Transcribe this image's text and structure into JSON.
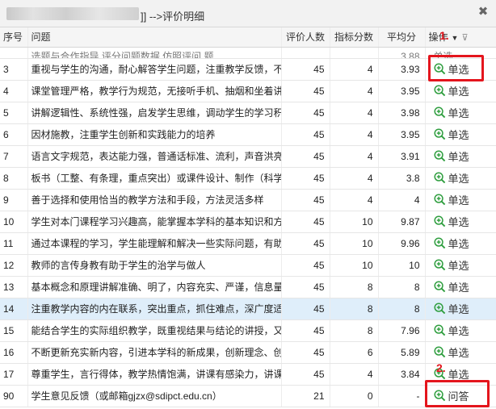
{
  "window": {
    "title": "]] -->评价明细",
    "close_icon": "close-icon"
  },
  "columns": {
    "seq": "序号",
    "question": "问题",
    "raters": "评价人数",
    "score": "指标分数",
    "avg": "平均分",
    "op": "操作"
  },
  "first_row_partial": {
    "seq": "",
    "question": "选题与合作指导 评分问题数据 仿照评问 题",
    "raters": "",
    "score": "",
    "avg": "3.88",
    "op": "单选"
  },
  "rows": [
    {
      "seq": "3",
      "question": "重视与学生的沟通，耐心解答学生问题，注重教学反馈，不断",
      "raters": "45",
      "score": "4",
      "avg": "3.93",
      "op": "单选"
    },
    {
      "seq": "4",
      "question": "课堂管理严格，教学行为规范，无接听手机、抽烟和坐着讲课",
      "raters": "45",
      "score": "4",
      "avg": "3.95",
      "op": "单选"
    },
    {
      "seq": "5",
      "question": "讲解逻辑性、系统性强，启发学生思维，调动学生的学习积极",
      "raters": "45",
      "score": "4",
      "avg": "3.98",
      "op": "单选"
    },
    {
      "seq": "6",
      "question": "因材施教，注重学生创新和实践能力的培养",
      "raters": "45",
      "score": "4",
      "avg": "3.95",
      "op": "单选"
    },
    {
      "seq": "7",
      "question": "语言文字规范，表达能力强，普通话标准、流利，声音洪亮",
      "raters": "45",
      "score": "4",
      "avg": "3.91",
      "op": "单选"
    },
    {
      "seq": "8",
      "question": "板书（工整、有条理，重点突出）或课件设计、制作（科学",
      "raters": "45",
      "score": "4",
      "avg": "3.8",
      "op": "单选"
    },
    {
      "seq": "9",
      "question": "善于选择和使用恰当的教学方法和手段，方法灵活多样",
      "raters": "45",
      "score": "4",
      "avg": "4",
      "op": "单选"
    },
    {
      "seq": "10",
      "question": "学生对本门课程学习兴趣高，能掌握本学科的基本知识和方法",
      "raters": "45",
      "score": "10",
      "avg": "9.87",
      "op": "单选"
    },
    {
      "seq": "11",
      "question": "通过本课程的学习，学生能理解和解决一些实际问题，有助于",
      "raters": "45",
      "score": "10",
      "avg": "9.96",
      "op": "单选"
    },
    {
      "seq": "12",
      "question": "教师的言传身教有助于学生的治学与做人",
      "raters": "45",
      "score": "10",
      "avg": "10",
      "op": "单选"
    },
    {
      "seq": "13",
      "question": "基本概念和原理讲解准确、明了，内容充实、严谨，信息量大",
      "raters": "45",
      "score": "8",
      "avg": "8",
      "op": "单选"
    },
    {
      "seq": "14",
      "question": "注重教学内容的内在联系，突出重点，抓住难点，深广度适宜",
      "raters": "45",
      "score": "8",
      "avg": "8",
      "op": "单选"
    },
    {
      "seq": "15",
      "question": "能结合学生的实际组织教学，既重视结果与结论的讲授，又重",
      "raters": "45",
      "score": "8",
      "avg": "7.96",
      "op": "单选"
    },
    {
      "seq": "16",
      "question": "不断更新充实新内容，引进本学科的新成果，创新理念、创新",
      "raters": "45",
      "score": "6",
      "avg": "5.89",
      "op": "单选"
    },
    {
      "seq": "17",
      "question": "尊重学生，言行得体，教学热情饱满，讲课有感染力，讲课富",
      "raters": "45",
      "score": "4",
      "avg": "3.84",
      "op": "单选"
    },
    {
      "seq": "90",
      "question": "学生意见反馈（或邮箱gjzx@sdipct.edu.cn）",
      "raters": "21",
      "score": "0",
      "avg": "-",
      "op": "问答"
    }
  ],
  "selected_row_seq": "14",
  "annotations": {
    "a1": "1.",
    "a2": "2."
  },
  "colors": {
    "highlight": "#e4151d",
    "selected_row": "#dfeefa",
    "icon_green": "#2f9e3f"
  }
}
